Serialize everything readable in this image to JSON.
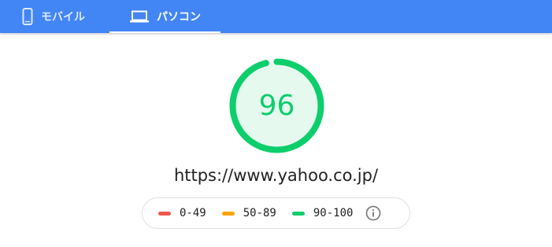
{
  "tabs": [
    {
      "label": "モバイル",
      "icon": "smartphone-icon",
      "selected": false
    },
    {
      "label": "パソコン",
      "icon": "laptop-icon",
      "selected": true
    }
  ],
  "gauge": {
    "score": "96",
    "fraction": 0.96
  },
  "url": "https://www.yahoo.co.jp/",
  "legend": [
    {
      "range": "0-49",
      "color": "#f0564c"
    },
    {
      "range": "50-89",
      "color": "#ffa400"
    },
    {
      "range": "90-100",
      "color": "#0cce6b"
    }
  ],
  "colors": {
    "header": "#4285f4",
    "pass": "#0cce6b",
    "pass_fill": "#e6f9ef"
  },
  "info_icon": "info-icon"
}
